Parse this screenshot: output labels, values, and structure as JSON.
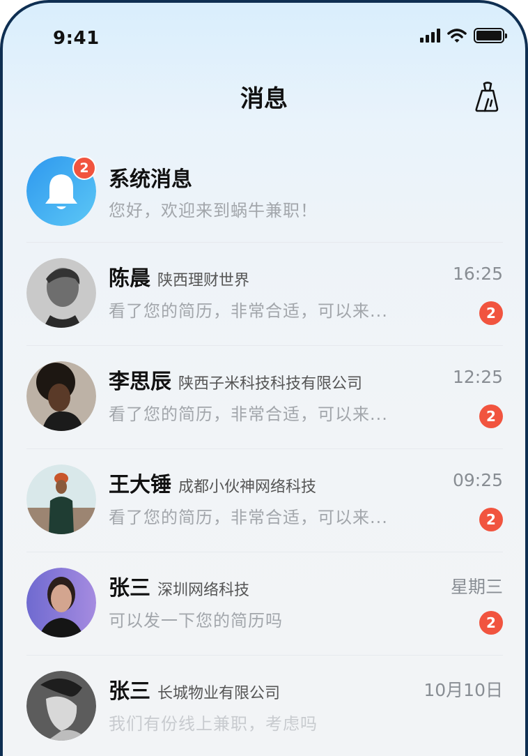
{
  "status_bar": {
    "time": "9:41"
  },
  "nav": {
    "title": "消息",
    "clean_icon": "broom-icon"
  },
  "system_message": {
    "name": "系统消息",
    "preview": "您好，欢迎来到蜗牛兼职！",
    "badge": "2",
    "icon": "bell-icon"
  },
  "messages": [
    {
      "name": "陈晨",
      "company": "陕西理财世界",
      "preview": "看了您的简历，非常合适，可以来...",
      "time": "16:25",
      "badge": "2"
    },
    {
      "name": "李思辰",
      "company": "陕西子米科技科技有限公司",
      "preview": "看了您的简历，非常合适，可以来...",
      "time": "12:25",
      "badge": "2"
    },
    {
      "name": "王大锤",
      "company": "成都小伙神网络科技",
      "preview": "看了您的简历，非常合适，可以来...",
      "time": "09:25",
      "badge": "2"
    },
    {
      "name": "张三",
      "company": "深圳网络科技",
      "preview": "可以发一下您的简历吗",
      "time": "星期三",
      "badge": "2"
    },
    {
      "name": "张三",
      "company": "长城物业有限公司",
      "preview": "我们有份线上兼职，考虑吗",
      "time": "10月10日"
    }
  ],
  "colors": {
    "badge": "#f1543f",
    "accent_blue": "#3aaaf0"
  }
}
